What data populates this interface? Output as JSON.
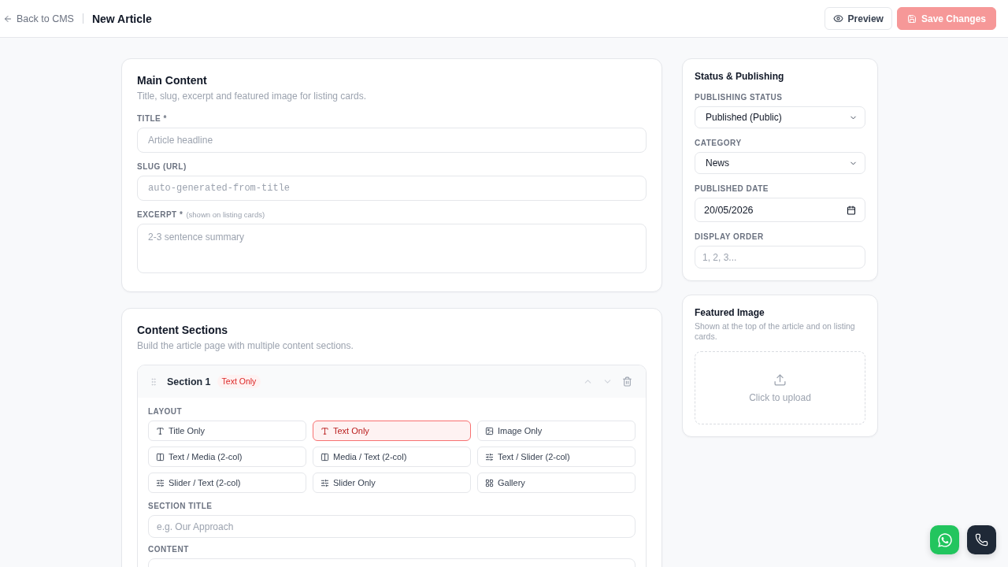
{
  "header": {
    "back_link": "Back to CMS",
    "title": "New Article",
    "buttons": [
      {
        "kind": "preview",
        "label": "Preview",
        "disabled": false
      },
      {
        "kind": "save",
        "label": "Save Changes",
        "disabled": true
      }
    ]
  },
  "main_content": {
    "title": "Main Content",
    "description": "Title, slug, excerpt and featured image for listing cards.",
    "fields": [
      {
        "kind": "text",
        "label": "TITLE *",
        "placeholder": "Article headline"
      },
      {
        "kind": "mono",
        "label": "SLUG (URL)",
        "placeholder": "auto-generated-from-title"
      },
      {
        "kind": "textarea",
        "label": "EXCERPT *",
        "hint": "(shown on listing cards)",
        "placeholder": "2-3 sentence summary"
      }
    ]
  },
  "content_sections": {
    "title": "Content Sections",
    "description": "Build the article page with multiple content sections.",
    "sections": [
      {
        "title": "Section 1",
        "badge": "Text Only",
        "controls": [
          {
            "kind": "up",
            "disabled": true
          },
          {
            "kind": "down",
            "disabled": true
          },
          {
            "kind": "delete",
            "disabled": false
          }
        ],
        "layout_label": "LAYOUT",
        "layouts": [
          {
            "kind": "text",
            "label": "Title Only",
            "selected": false
          },
          {
            "kind": "text",
            "label": "Text Only",
            "selected": true
          },
          {
            "kind": "image",
            "label": "Image Only",
            "selected": false
          },
          {
            "kind": "split",
            "label": "Text / Media (2-col)",
            "selected": false
          },
          {
            "kind": "split",
            "label": "Media / Text (2-col)",
            "selected": false
          },
          {
            "kind": "slider",
            "label": "Text / Slider (2-col)",
            "selected": false
          },
          {
            "kind": "slider",
            "label": "Slider / Text (2-col)",
            "selected": false
          },
          {
            "kind": "slider",
            "label": "Slider Only",
            "selected": false
          },
          {
            "kind": "gallery",
            "label": "Gallery",
            "selected": false
          }
        ],
        "fields": [
          {
            "kind": "text",
            "label": "SECTION TITLE",
            "placeholder": "e.g. Our Approach"
          },
          {
            "kind": "textarea",
            "label": "CONTENT"
          }
        ]
      }
    ]
  },
  "status_publishing": {
    "title": "Status & Publishing",
    "fields": [
      {
        "kind": "select",
        "label": "PUBLISHING STATUS",
        "value": "Published (Public)"
      },
      {
        "kind": "select",
        "label": "CATEGORY",
        "value": "News"
      },
      {
        "kind": "date",
        "label": "PUBLISHED DATE",
        "value": "20/05/2026"
      },
      {
        "kind": "text",
        "label": "DISPLAY ORDER",
        "placeholder": "1, 2, 3..."
      }
    ]
  },
  "featured_image": {
    "title": "Featured Image",
    "description": "Shown at the top of the article and on listing cards.",
    "upload_label": "Click to upload"
  },
  "floating_buttons": [
    {
      "kind": "whatsapp"
    },
    {
      "kind": "phone"
    }
  ]
}
